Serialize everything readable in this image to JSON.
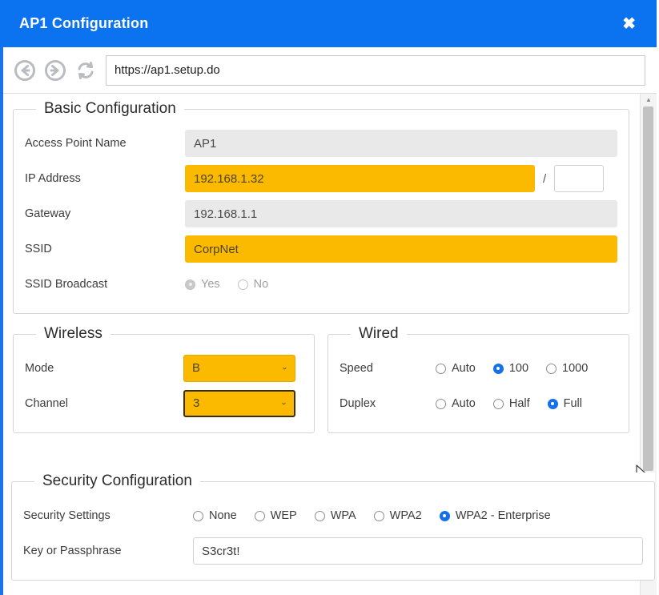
{
  "window": {
    "title": "AP1 Configuration",
    "close_label": "✖",
    "accent_color": "#0b72f0",
    "highlight_color": "#fbba00"
  },
  "navbar": {
    "back_icon": "back-arrow-icon",
    "forward_icon": "forward-arrow-icon",
    "refresh_icon": "refresh-icon",
    "url": "https://ap1.setup.do"
  },
  "basic": {
    "legend": "Basic Configuration",
    "ap_name": {
      "label": "Access Point Name",
      "value": "AP1"
    },
    "ip_address": {
      "label": "IP Address",
      "value": "192.168.1.32",
      "separator": "/",
      "subnet_value": ""
    },
    "gateway": {
      "label": "Gateway",
      "value": "192.168.1.1"
    },
    "ssid": {
      "label": "SSID",
      "value": "CorpNet"
    },
    "ssid_broadcast": {
      "label": "SSID Broadcast",
      "options": [
        "Yes",
        "No"
      ],
      "selected": "Yes"
    }
  },
  "wireless": {
    "legend": "Wireless",
    "mode": {
      "label": "Mode",
      "value": "B",
      "caret": "⌄"
    },
    "channel": {
      "label": "Channel",
      "value": "3",
      "caret": "⌄"
    }
  },
  "wired": {
    "legend": "Wired",
    "speed": {
      "label": "Speed",
      "options": [
        "Auto",
        "100",
        "1000"
      ],
      "selected": "100"
    },
    "duplex": {
      "label": "Duplex",
      "options": [
        "Auto",
        "Half",
        "Full"
      ],
      "selected": "Full"
    }
  },
  "security": {
    "legend": "Security Configuration",
    "settings": {
      "label": "Security Settings",
      "options": [
        "None",
        "WEP",
        "WPA",
        "WPA2",
        "WPA2 - Enterprise"
      ],
      "selected": "WPA2 - Enterprise"
    },
    "key": {
      "label": "Key or Passphrase",
      "value": "S3cr3t!"
    }
  },
  "scrollbar": {
    "up_arrow": "▲"
  }
}
